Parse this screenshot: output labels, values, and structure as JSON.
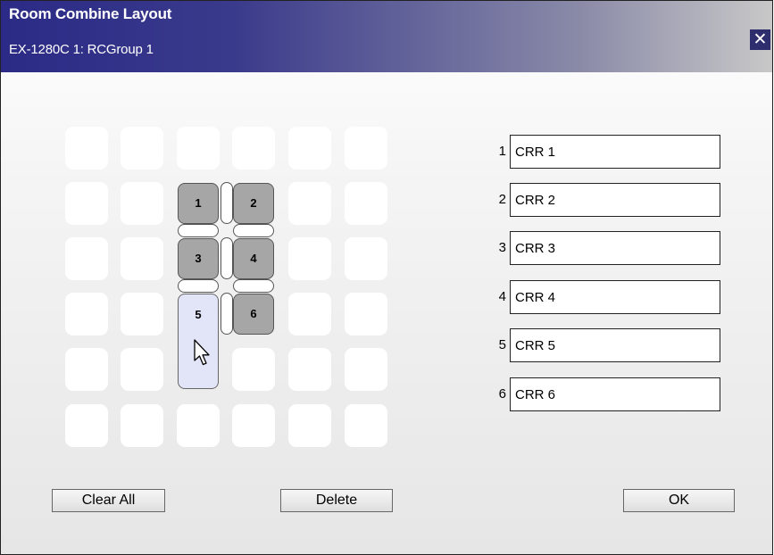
{
  "dialog": {
    "title": "Room Combine Layout",
    "subtitle": "EX-1280C 1: RCGroup 1",
    "close_icon": "✕"
  },
  "grid": {
    "rows": 6,
    "cols": 6,
    "rooms": [
      {
        "label": "1",
        "row": 2,
        "col": 3,
        "selected": false
      },
      {
        "label": "2",
        "row": 2,
        "col": 4,
        "selected": false
      },
      {
        "label": "3",
        "row": 3,
        "col": 3,
        "selected": false
      },
      {
        "label": "4",
        "row": 3,
        "col": 4,
        "selected": false
      },
      {
        "label": "5",
        "row": 4,
        "col": 3,
        "selected": true
      },
      {
        "label": "6",
        "row": 4,
        "col": 4,
        "selected": false
      }
    ]
  },
  "room_names": [
    {
      "index": "1",
      "name": "CRR 1"
    },
    {
      "index": "2",
      "name": "CRR 2"
    },
    {
      "index": "3",
      "name": "CRR 3"
    },
    {
      "index": "4",
      "name": "CRR 4"
    },
    {
      "index": "5",
      "name": "CRR 5"
    },
    {
      "index": "6",
      "name": "CRR 6"
    }
  ],
  "buttons": {
    "clear_all": "Clear All",
    "delete": "Delete",
    "ok": "OK"
  },
  "colors": {
    "title_gradient_start": "#2b2a86",
    "room_gray": "#a6a6a6",
    "room_selected": "#e2e4f8"
  }
}
